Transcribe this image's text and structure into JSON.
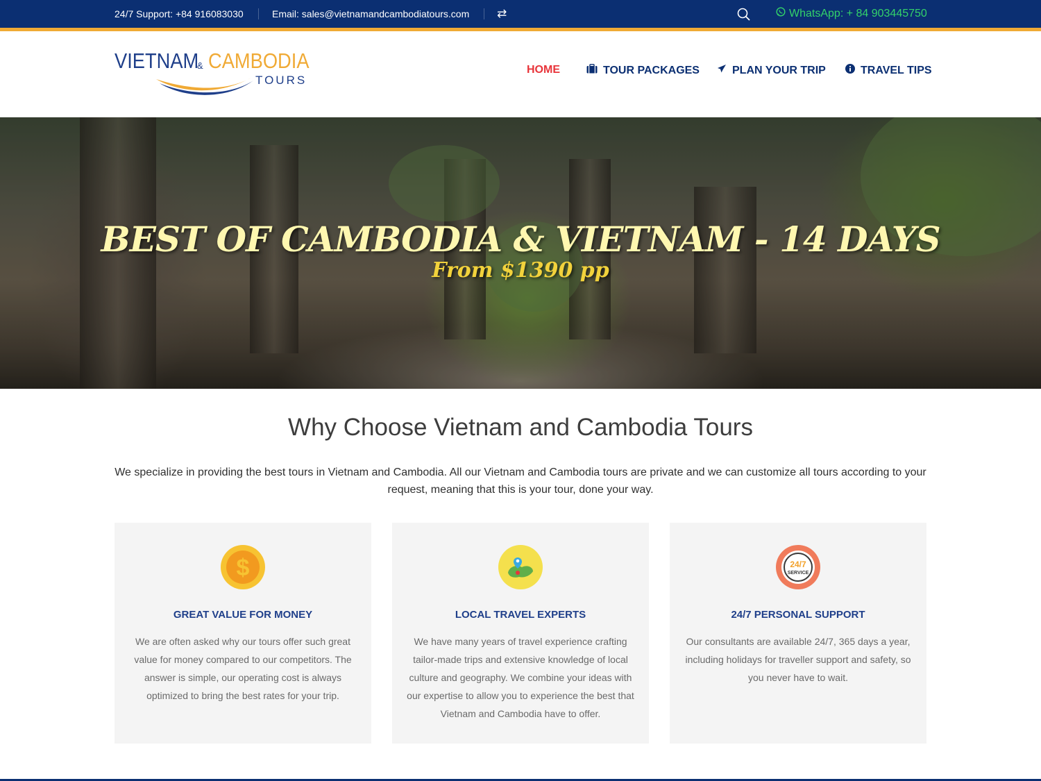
{
  "topbar": {
    "support": "24/7 Support: +84 916083030",
    "email": "Email: sales@vietnamandcambodiatours.com",
    "switch_icon": "swap-arrows-icon",
    "search_icon": "search-icon",
    "whatsapp": "WhatsApp: + 84 903445750",
    "whatsapp_icon": "whatsapp-icon"
  },
  "logo": {
    "word1": "VIETNAM",
    "amp": "&",
    "word2": "CAMBODIA",
    "word3": "TOURS"
  },
  "nav": [
    {
      "label": "HOME",
      "icon": ""
    },
    {
      "label": "TOUR PACKAGES",
      "icon": "suitcase-icon"
    },
    {
      "label": "PLAN YOUR TRIP",
      "icon": "plane-icon"
    },
    {
      "label": "TRAVEL TIPS",
      "icon": "info-icon"
    }
  ],
  "hero": {
    "title": "BEST OF CAMBODIA & VIETNAM - 14 DAYS",
    "subtitle": "From $1390 pp"
  },
  "why": {
    "title": "Why Choose Vietnam and Cambodia Tours",
    "text": "We specialize in providing the best tours in Vietnam and Cambodia. All our Vietnam and Cambodia tours are private and we can customize all tours according to your request, meaning that this is your tour, done your way."
  },
  "cards": [
    {
      "icon": "dollar-coin-icon",
      "title": "GREAT VALUE FOR MONEY",
      "text": "We are often asked why our tours offer such great value for money compared to our competitors. The answer is simple, our operating cost is always optimized to bring the best rates for your trip."
    },
    {
      "icon": "map-pin-icon",
      "title": "LOCAL TRAVEL EXPERTS",
      "text": "We have many years of travel experience crafting tailor-made trips and extensive knowledge of local culture and geography. We combine your ideas with our expertise to allow you to experience the best that Vietnam and Cambodia have to offer."
    },
    {
      "icon": "service-24-7-icon",
      "title": "24/7 PERSONAL SUPPORT",
      "text": "Our consultants are available 24/7, 365 days a year, including holidays for traveller support and safety, so you never have to wait.",
      "badge_top": "24/7",
      "badge_bottom": "SERVICE"
    }
  ],
  "colors": {
    "topbar": "#0b2f72",
    "accent_orange": "#f0aa35",
    "nav_active": "#e8343a",
    "nav": "#0b2f72",
    "whatsapp": "#33d26a"
  }
}
